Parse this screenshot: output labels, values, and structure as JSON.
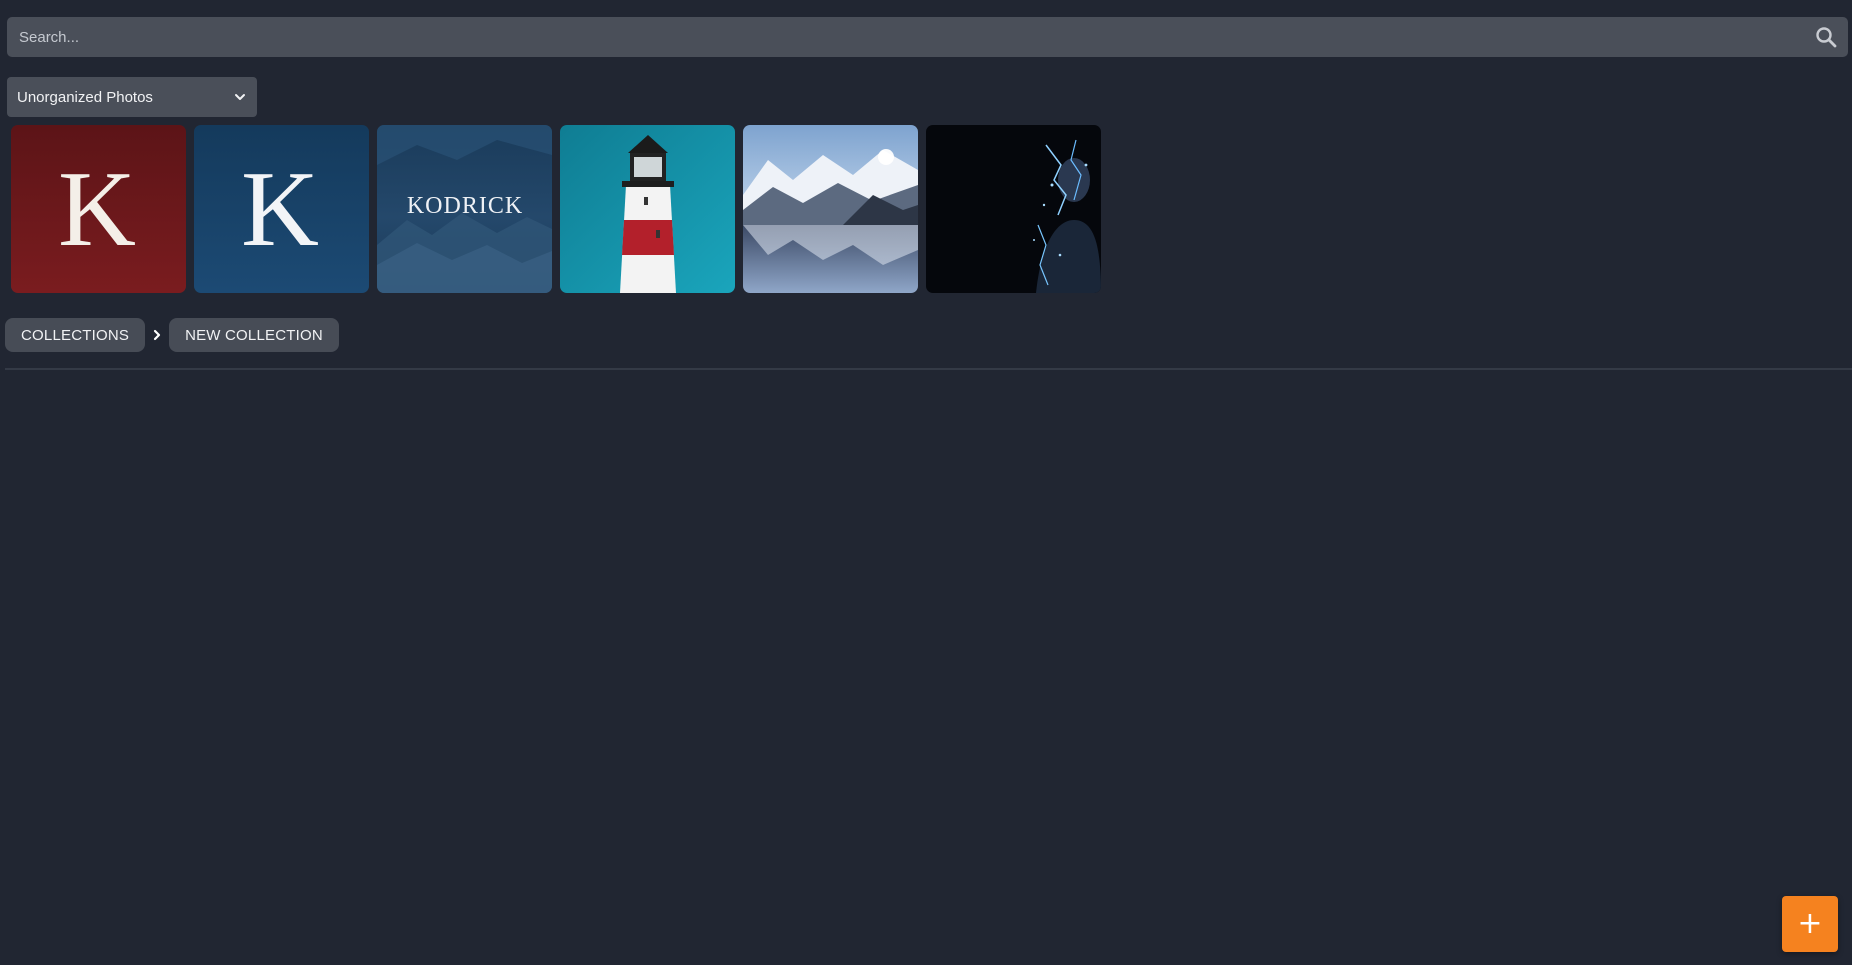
{
  "search": {
    "placeholder": "Search...",
    "value": "",
    "icon": "search-icon"
  },
  "album_select": {
    "selected": "Unorganized Photos",
    "icon": "chevron-down-icon"
  },
  "photos": [
    {
      "name": "k-logo-red",
      "text": "K"
    },
    {
      "name": "k-logo-blue",
      "text": "K"
    },
    {
      "name": "kodrick-mountains",
      "text": "KODRICK"
    },
    {
      "name": "lighthouse"
    },
    {
      "name": "snowy-lake"
    },
    {
      "name": "glitch-portrait"
    }
  ],
  "breadcrumb": {
    "items": [
      "COLLECTIONS",
      "NEW COLLECTION"
    ],
    "separator_icon": "chevron-right-icon"
  },
  "fab": {
    "label": "+",
    "color": "#f5821f"
  },
  "colors": {
    "background": "#212632",
    "control": "#4a4f59",
    "accent": "#f5821f"
  }
}
